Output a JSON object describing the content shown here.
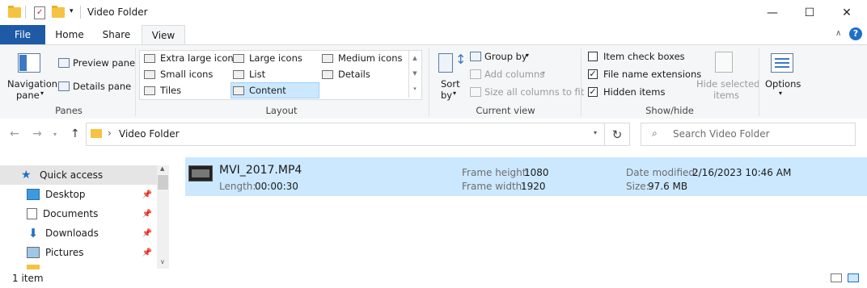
{
  "window": {
    "title": "Video Folder",
    "controls": {
      "minimize": "—",
      "maximize": "☐",
      "close": "✕"
    }
  },
  "ribbon_tabs": [
    "File",
    "Home",
    "Share",
    "View"
  ],
  "ribbon": {
    "panes": {
      "label": "Panes",
      "navigation_pane_line1": "Navigation",
      "navigation_pane_line2": "pane",
      "preview_pane": "Preview pane",
      "details_pane": "Details pane"
    },
    "layout": {
      "label": "Layout",
      "items": [
        "Extra large icons",
        "Large icons",
        "Medium icons",
        "Small icons",
        "List",
        "Details",
        "Tiles",
        "Content"
      ],
      "selected": "Content"
    },
    "current_view": {
      "label": "Current view",
      "sort_line1": "Sort",
      "sort_line2": "by",
      "group_by": "Group by",
      "add_columns": "Add columns",
      "size_all_columns": "Size all columns to fit"
    },
    "show_hide": {
      "label": "Show/hide",
      "item_check_boxes": "Item check boxes",
      "item_check_boxes_checked": false,
      "file_name_extensions": "File name extensions",
      "file_name_extensions_checked": true,
      "hidden_items": "Hidden items",
      "hidden_items_checked": true,
      "hide_selected_line1": "Hide selected",
      "hide_selected_line2": "items"
    },
    "options": "Options"
  },
  "address": {
    "path": "Video Folder",
    "separator": "›",
    "search_placeholder": "Search Video Folder"
  },
  "nav_pane": {
    "items": [
      {
        "label": "Quick access",
        "pinned": false,
        "selected": true
      },
      {
        "label": "Desktop",
        "pinned": true
      },
      {
        "label": "Documents",
        "pinned": true
      },
      {
        "label": "Downloads",
        "pinned": true
      },
      {
        "label": "Pictures",
        "pinned": true
      }
    ]
  },
  "files": [
    {
      "name": "MVI_2017.MP4",
      "length_label": "Length:",
      "length": "00:00:30",
      "frame_height_label": "Frame height:",
      "frame_height": "1080",
      "frame_width_label": "Frame width:",
      "frame_width": "1920",
      "date_modified_label": "Date modified:",
      "date_modified": "2/16/2023 10:46 AM",
      "size_label": "Size:",
      "size": "97.6 MB"
    }
  ],
  "status": {
    "item_count": "1 item"
  },
  "colors": {
    "accent": "#1f5aa6",
    "selection": "#cce8ff",
    "ribbon_bg": "#f5f6f7"
  }
}
